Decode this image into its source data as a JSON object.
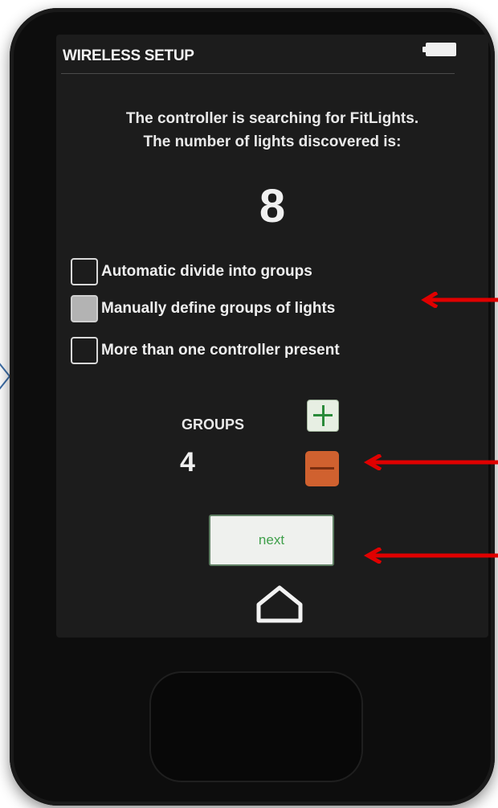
{
  "header": {
    "title": "WIRELESS SETUP"
  },
  "status": {
    "line1": "The controller is searching for FitLights.",
    "line2": "The number of lights discovered is:",
    "count": "8"
  },
  "options": [
    {
      "label": "Automatic divide into groups",
      "checked": false
    },
    {
      "label": "Manually define groups of lights",
      "checked": true
    },
    {
      "label": "More than one controller present",
      "checked": false
    }
  ],
  "groups": {
    "label": "GROUPS",
    "value": "4"
  },
  "buttons": {
    "next_label": "next"
  },
  "icons": {
    "plus": "plus-icon",
    "minus": "minus-icon",
    "home": "home-icon",
    "battery": "battery-icon"
  },
  "colors": {
    "screen_bg": "#1c1c1c",
    "plus_bg": "#e7efe3",
    "plus_glyph": "#2a8a3a",
    "minus_bg": "#d0612f",
    "next_text": "#3f9f4a",
    "annotation_arrow": "#e00000"
  }
}
